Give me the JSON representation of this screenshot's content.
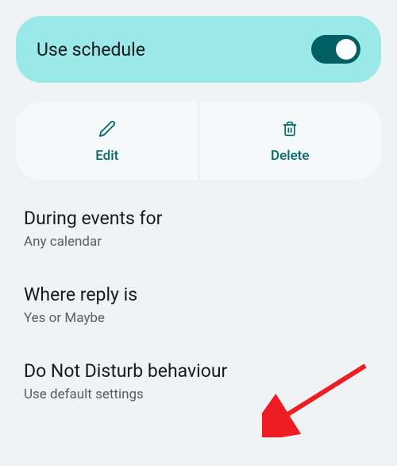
{
  "schedule": {
    "label": "Use schedule",
    "toggle_on": true
  },
  "actions": {
    "edit": "Edit",
    "delete": "Delete"
  },
  "settings": [
    {
      "title": "During events for",
      "subtitle": "Any calendar"
    },
    {
      "title": "Where reply is",
      "subtitle": "Yes or Maybe"
    },
    {
      "title": "Do Not Disturb behaviour",
      "subtitle": "Use default settings"
    }
  ]
}
